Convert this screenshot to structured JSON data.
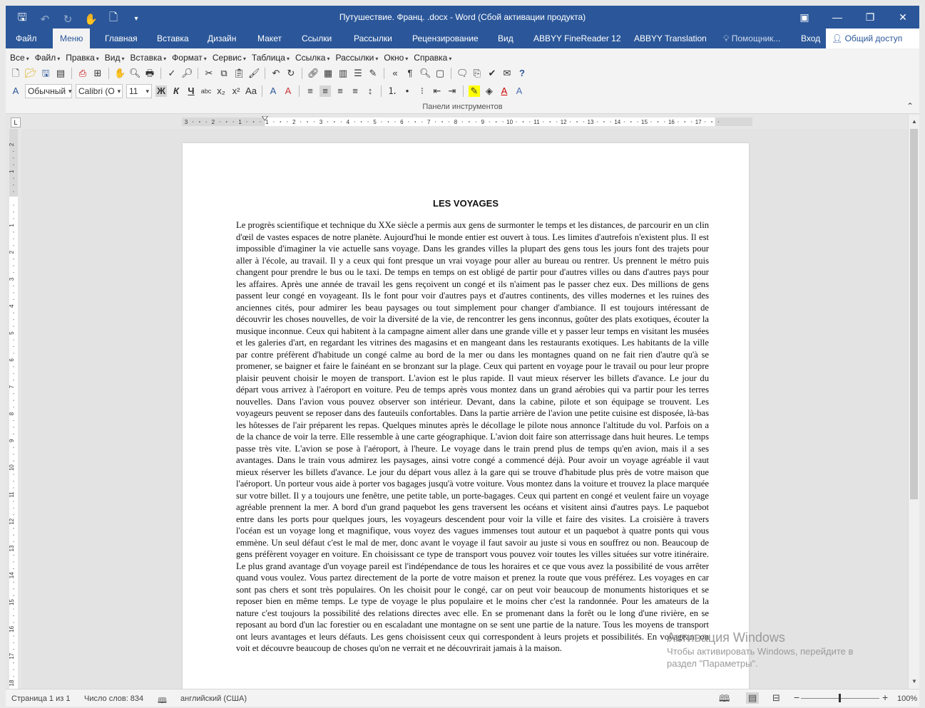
{
  "window": {
    "title": "Путушествие. Франц. .docx - Word (Сбой активации продукта)"
  },
  "tabs": [
    "Файл",
    "Меню",
    "Главная",
    "Вставка",
    "Дизайн",
    "Макет",
    "Ссылки",
    "Рассылки",
    "Рецензирование",
    "Вид",
    "ABBYY FineReader 12",
    "ABBYY Translation"
  ],
  "active_tab": "Меню",
  "tell_me": "Помощник...",
  "sign_in": "Вход",
  "share": "Общий доступ",
  "menu_items": [
    "Все",
    "Файл",
    "Правка",
    "Вид",
    "Вставка",
    "Формат",
    "Сервис",
    "Таблица",
    "Ссылка",
    "Рассылки",
    "Окно",
    "Справка"
  ],
  "style_combo": "Обычный",
  "font_combo": "Calibri (О",
  "size_combo": "11",
  "panel_caption": "Панели инструментов",
  "document": {
    "title": "LES VOYAGES",
    "body": "Le progrès scientifique et technique du XXe siècle a permis aux gens de surmonter le temps et les distances, de parcourir en un clin d'œil de vastes espaces de notre planète. Aujourd'hui le monde entier est ouvert à tous. Les limites d'autrefois n'existent plus. Il est impossible d'imaginer la vie actuelle sans voyage. Dans les grandes villes la plupart des gens tous les jours font des trajets pour aller à l'école, au travail. Il y a ceux qui font presque un vrai voyage pour aller au bureau ou rentrer. Us prennent le métro puis changent pour prendre le bus ou le taxi. De temps en temps on est obligé de partir pour d'autres villes ou dans d'autres pays pour les affaires. Après une année de travail les gens reçoivent un congé et ils n'aiment pas le passer chez eux. Des millions de gens passent leur congé en voyageant. Ils le font pour voir d'autres pays et d'autres continents, des villes modernes et les ruines des anciennes cités, pour admirer les beau paysages ou tout simplement pour changer d'ambiance. Il est toujours intéressant de découvrir les choses nouvelles, de voir la diversité de la vie, de rencontrer les gens inconnus, goûter des plats exotiques, écouter la musique inconnue. Ceux qui habitent à la campagne aiment aller dans une grande ville et y passer leur temps en visitant les musées et les galeries d'art, en regardant les vitrines des magasins et en mangeant dans les restaurants exotiques. Les habitants de la ville par contre préfèrent d'habitude un congé calme au bord de la mer ou dans les montagnes quand on ne fait rien d'autre qu'à se promener, se baigner et faire le fainéant en se bronzant sur la plage. Ceux qui partent en voyage pour le travail ou pour leur propre plaisir peuvent choisir le moyen de transport. L'avion est le plus rapide. Il vaut mieux réserver les billets d'avance. Le jour du départ vous arrivez à l'aéroport en voiture. Peu de temps après vous montez dans un grand aérobies qui va partir pour les terres nouvelles. Dans l'avion vous pouvez observer son intérieur. Devant, dans la cabine, pilote et son équipage se trouvent. Les voyageurs peuvent se reposer dans des fauteuils confortables. Dans la partie arrière de l'avion une petite cuisine est disposée, là-bas les hôtesses de l'air préparent les repas. Quelques minutes après le décollage le pilote nous annonce l'altitude du vol. Parfois on a de la chance de voir la terre. Elle ressemble à une carte géographique. L'avion doit faire son atterrissage dans huit heures. Le temps passe très vite. L'avion se pose à l'aéroport, à l'heure. Le voyage dans le train prend plus de temps qu'en avion, mais il a ses avantages. Dans le train vous admirez les paysages, ainsi votre congé a commencé déjà. Pour avoir un voyage agréable il vaut mieux réserver les billets d'avance. Le jour du départ vous allez à la gare qui se trouve d'habitude plus près de votre maison que l'aéroport. Un porteur vous aide à porter vos bagages jusqu'à votre voiture. Vous montez dans la voiture et trouvez la place marquée sur votre billet. Il y a toujours une fenêtre, une petite table, un porte-bagages. Ceux qui partent en congé et veulent faire un voyage agréable prennent la mer. A bord d'un grand paquebot les gens traversent les océans et visitent ainsi d'autres pays. Le paquebot entre dans les ports pour quelques jours, les voyageurs descendent pour voir la ville et faire des visites. La croisière à travers l'océan est un voyage long et magnifique, vous voyez des vagues immenses tout autour et un paquebot à quatre ponts qui vous emmène. Un seul défaut c'est le mal de mer, donc avant le voyage il faut savoir au juste si vous en souffrez ou non. Beaucoup de gens préfèrent voyager en voiture. En choisissant ce type de transport vous pouvez voir toutes les villes situées sur votre itinéraire. Le plus grand avantage d'un voyage pareil est l'indépendance de tous les horaires et ce que vous avez la possibilité de vous arrêter quand vous voulez. Vous partez directement de la porte de votre maison et prenez la route que vous préférez. Les voyages en car sont pas chers et sont très populaires. On les choisit pour le congé, car on peut voir beaucoup de monuments historiques et se reposer bien en même temps. Le type de voyage le plus populaire et le moins cher c'est la randonnée. Pour les amateurs de la nature c'est toujours la possibilité des relations directes avec elle. En se promenant dans la forêt ou le long d'une rivière, en se reposant au bord d'un lac forestier ou en escaladant une montagne on se sent une partie de la nature. Tous les moyens de transport ont leurs avantages et leurs défauts. Les gens choisissent ceux qui correspondent à leurs projets et possibilités. En voyageant on voit et découvre beaucoup de choses qu'on ne verrait et ne découvrirait jamais à la maison."
  },
  "watermark": {
    "line1": "Активация Windows",
    "line2": "Чтобы активировать Windows, перейдите в",
    "line3": "раздел \"Параметры\"."
  },
  "status": {
    "page": "Страница 1 из 1",
    "words": "Число слов: 834",
    "language": "английский (США)",
    "zoom": "100%"
  },
  "ruler": {
    "h_labels": [
      "3",
      "2",
      "1",
      "1",
      "2",
      "3",
      "4",
      "5",
      "6",
      "7",
      "8",
      "9",
      "10",
      "11",
      "12",
      "13",
      "14",
      "15",
      "16",
      "17"
    ]
  }
}
